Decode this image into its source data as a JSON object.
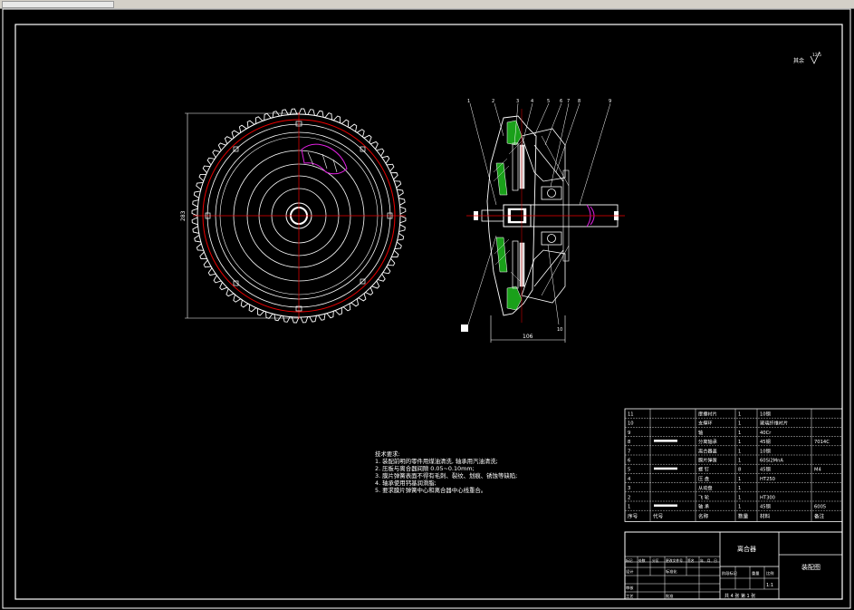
{
  "roughness": {
    "label": "其余",
    "value": "12.5"
  },
  "gear_view": {
    "diameter_dim": "283"
  },
  "section_view": {
    "width_dim": "106",
    "leader_numbers": [
      "1",
      "2",
      "3",
      "4",
      "5",
      "6",
      "7",
      "8",
      "9",
      "10"
    ]
  },
  "technical_requirements": {
    "title": "技术要求:",
    "items": [
      "1. 装配前明的零件用煤油清洗, 轴承用汽油清洗;",
      "2. 压板与离合器间隙 0.05~0.10mm;",
      "3. 膜片弹簧表面不得有毛刺、裂纹、划痕、锈蚀等缺陷;",
      "4. 轴承使用钙基润滑脂;",
      "5. 要求膜片弹簧中心和离合器中心线重合。"
    ]
  },
  "bom": {
    "header": {
      "no": "序号",
      "code": "代号",
      "name": "名称",
      "qty": "数量",
      "material": "材料",
      "note": "备注"
    },
    "rows": [
      {
        "no": "11",
        "code": "",
        "name": "摩擦衬片",
        "qty": "1",
        "material": "10钢",
        "note": ""
      },
      {
        "no": "10",
        "code": "",
        "name": "支撑环",
        "qty": "1",
        "material": "玻璃纤维衬片",
        "note": ""
      },
      {
        "no": "9",
        "code": "",
        "name": "轴",
        "qty": "1",
        "material": "40Cr",
        "note": ""
      },
      {
        "no": "8",
        "code": "",
        "name": "分离轴承",
        "qty": "1",
        "material": "45钢",
        "note": "7014C"
      },
      {
        "no": "7",
        "code": "",
        "name": "离合器盖",
        "qty": "1",
        "material": "10钢",
        "note": ""
      },
      {
        "no": "6",
        "code": "",
        "name": "膜片弹簧",
        "qty": "1",
        "material": "60Si2MnA",
        "note": ""
      },
      {
        "no": "5",
        "code": "",
        "name": "螺 钉",
        "qty": "8",
        "material": "45钢",
        "note": "M4"
      },
      {
        "no": "4",
        "code": "",
        "name": "压 盘",
        "qty": "1",
        "material": "HT250",
        "note": ""
      },
      {
        "no": "3",
        "code": "",
        "name": "从动盘",
        "qty": "1",
        "material": "",
        "note": ""
      },
      {
        "no": "2",
        "code": "",
        "name": "飞 轮",
        "qty": "1",
        "material": "HT300",
        "note": ""
      },
      {
        "no": "1",
        "code": "",
        "name": "轴 承",
        "qty": "1",
        "material": "45钢",
        "note": "6005"
      }
    ]
  },
  "title_block": {
    "part_name": "离合器",
    "drawing_type": "装配图",
    "scale": "1:1",
    "sheet_info": "共 4 张  第 1 张",
    "labels": [
      "标记",
      "处数",
      "分区",
      "更改文件号",
      "签名",
      "年、月、日",
      "设计",
      "标准化",
      "阶段标记",
      "重量",
      "比例",
      "审核",
      "工艺",
      "批准"
    ]
  }
}
